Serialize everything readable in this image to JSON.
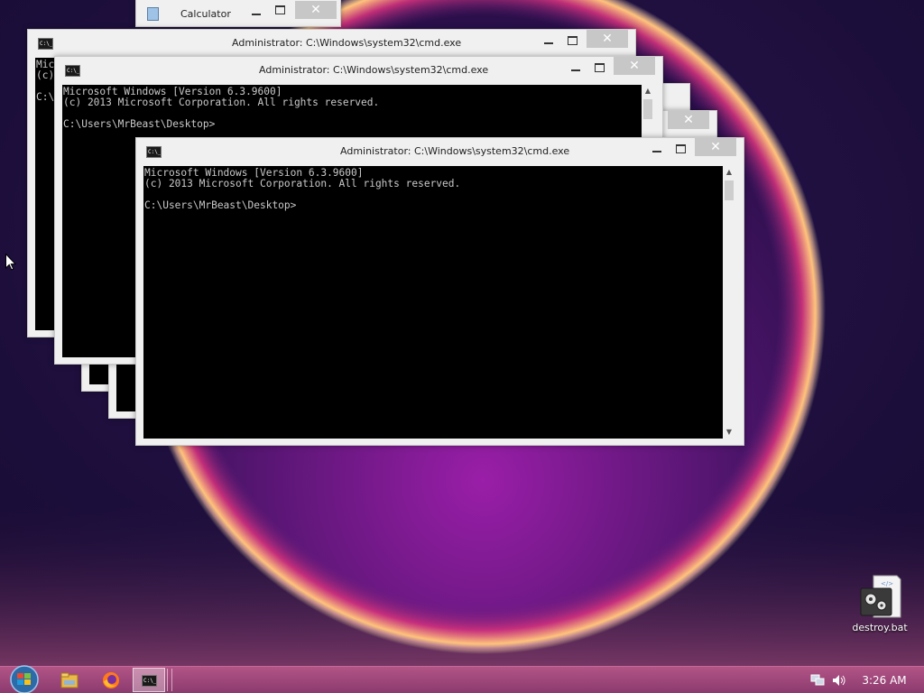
{
  "windows": {
    "calculator": {
      "title": "Calculator",
      "close_glyph": "✕"
    },
    "cmd_title": "Administrator: C:\\Windows\\system32\\cmd.exe",
    "close_glyph": "✕",
    "cmd_icon_text": "C:\\_",
    "console_lines": [
      "Microsoft Windows [Version 6.3.9600]",
      "(c) 2013 Microsoft Corporation. All rights reserved.",
      "",
      "C:\\Users\\MrBeast\\Desktop>"
    ],
    "console_partial": [
      "Micr",
      "(c)",
      "",
      "C:\\"
    ]
  },
  "desktop_icons": [
    {
      "label": "destroy.bat",
      "icon": "batch-file-gears-icon"
    }
  ],
  "taskbar": {
    "start": "start-orb-icon",
    "pinned": [
      "file-explorer-icon",
      "firefox-icon",
      "cmd-icon"
    ],
    "tray": [
      "network-icon",
      "volume-icon"
    ],
    "clock": "3:26 AM"
  },
  "colors": {
    "taskbar": "#a84b80",
    "console_bg": "#000000",
    "console_text": "#c9c9c9",
    "window_chrome": "#f0f0f0",
    "close_button": "#c7c7c7"
  }
}
